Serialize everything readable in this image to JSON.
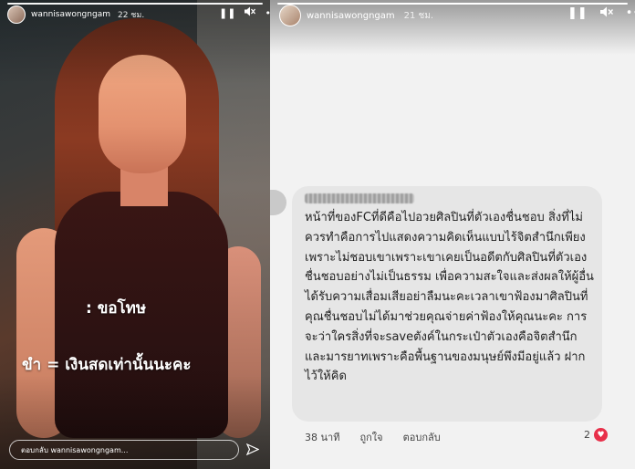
{
  "left_story": {
    "username": "wannisawongngam",
    "time": "22 ชม.",
    "overlay_line1": ": ขอโทษ",
    "overlay_line2": "ขำ = เงินสดเท่านั้นนะคะ",
    "reply_placeholder": "ตอบกลับ wannisawongngam...",
    "icons": [
      "pause-icon",
      "mute-icon",
      "more-icon",
      "send-icon"
    ]
  },
  "right_story": {
    "username": "wannisawongngam",
    "time": "21 ชม.",
    "comment": {
      "text": "หน้าที่ของFCที่ดีคือไปอวยศิลปินที่ตัวเองชื่นชอบ สิ่งที่ไม่ควรทำคือการไปแสดงความคิดเห็นแบบไร้จิตสำนึกเพียงเพราะไม่ชอบเขาเพราะเขาเคยเป็นอดีตกับศิลปินที่ตัวเองชื่นชอบอย่างไม่เป็นธรรม เพื่อความสะใจและส่งผลให้ผู้อื่นได้รับความเสื่อมเสียอย่าลืมนะคะเวลาเขาฟ้องมาศิลปินที่คุณชื่นชอบไม่ได้มาช่วยคุณจ่ายค่าฟ้องให้คุณนะคะ การจะว่าใครสิ่งที่จะsaveตังค์ในกระเป๋าตัวเองคือจิตสำนึกและมารยาทเพราะคือพื้นฐานของมนุษย์พึงมีอยู่แล้ว ฝากไว้ให้คิด",
      "time": "38 นาที",
      "like_label": "ถูกใจ",
      "reply_label": "ตอบกลับ",
      "like_count": "2"
    },
    "icons": [
      "pause-icon",
      "mute-icon",
      "more-icon",
      "heart-icon"
    ]
  },
  "colors": {
    "heart": "#e8304a",
    "bubble": "#e6e6e6"
  }
}
